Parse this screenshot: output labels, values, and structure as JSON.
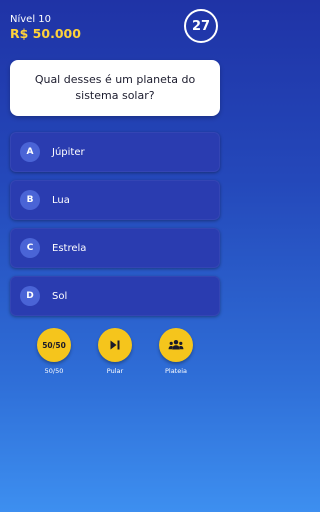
{
  "header": {
    "level": "Nível 10",
    "prize": "R$ 50.000",
    "timer": "27"
  },
  "question": {
    "text": "Qual desses é um planeta do sistema solar?"
  },
  "options": [
    {
      "letter": "A",
      "text": "Júpiter"
    },
    {
      "letter": "B",
      "text": "Lua"
    },
    {
      "letter": "C",
      "text": "Estrela"
    },
    {
      "letter": "D",
      "text": "Sol"
    }
  ],
  "lifelines": [
    {
      "button_text": "50/50",
      "caption": "50/50",
      "icon": "fifty-fifty"
    },
    {
      "button_text": "",
      "caption": "Pular",
      "icon": "skip-icon"
    },
    {
      "button_text": "",
      "caption": "Plateia",
      "icon": "audience-icon"
    }
  ],
  "colors": {
    "accent": "#f5c51c",
    "prize": "#ffd23a",
    "option_bg": "#2a3cb0",
    "letter_bg": "#4a64d6"
  }
}
